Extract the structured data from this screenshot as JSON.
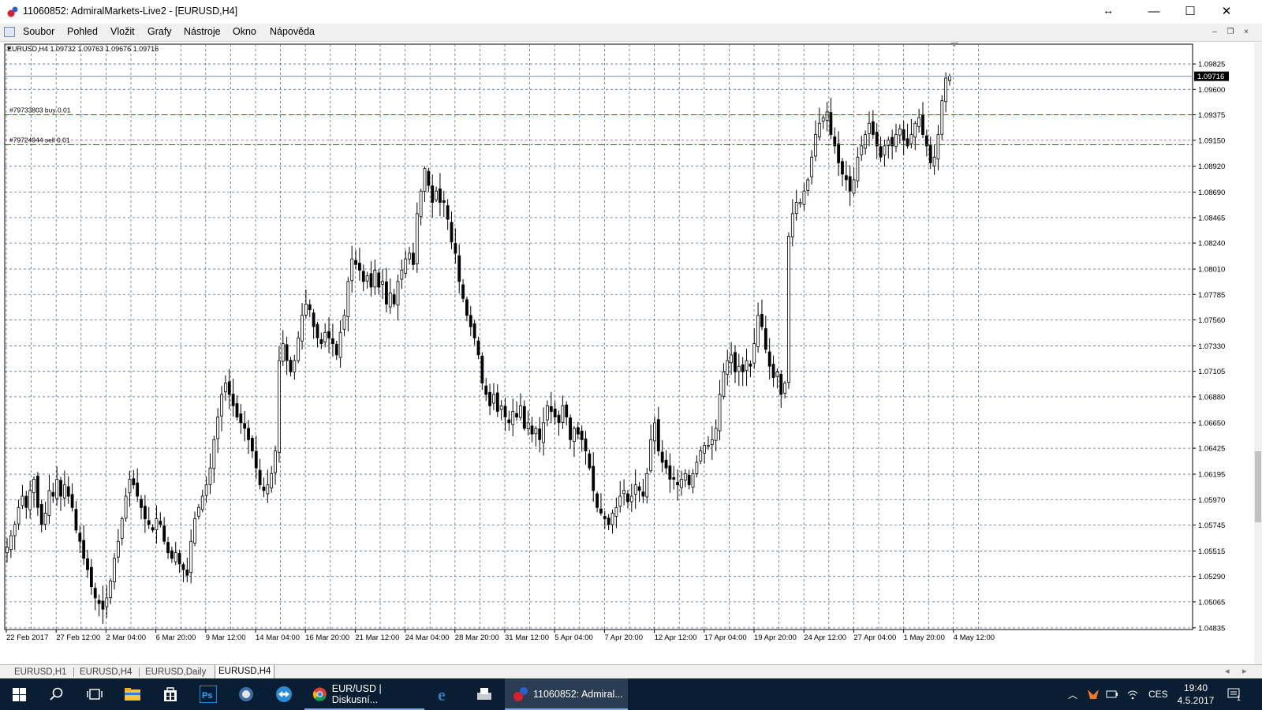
{
  "window": {
    "title": "11060852: AdmiralMarkets-Live2 - [EURUSD,H4]",
    "controls": {
      "minimize": "—",
      "maximize": "☐",
      "close": "✕"
    },
    "resize_glyph": "↔"
  },
  "menu": {
    "items": [
      "Soubor",
      "Pohled",
      "Vložit",
      "Grafy",
      "Nástroje",
      "Okno",
      "Nápověda"
    ],
    "mdi": {
      "minimize": "–",
      "restore": "❐",
      "close": "×"
    }
  },
  "chart": {
    "info": "EURUSD,H4  1.09732 1.09763 1.09676 1.09716",
    "current_price": "1.09716",
    "orders": [
      {
        "label": "#79733803 buy 0.01",
        "price": 1.09375,
        "color": "#ff0000"
      },
      {
        "label": "#79724944 sell 0.01",
        "price": 1.0911,
        "color": "#ff0000"
      }
    ]
  },
  "chart_data": {
    "type": "candlestick",
    "symbol": "EURUSD",
    "timeframe": "H4",
    "ylim": [
      1.0482,
      1.1
    ],
    "y_ticks": [
      "1.09825",
      "1.09600",
      "1.09375",
      "1.09150",
      "1.08920",
      "1.08690",
      "1.08465",
      "1.08240",
      "1.08010",
      "1.07785",
      "1.07560",
      "1.07330",
      "1.07105",
      "1.06880",
      "1.06650",
      "1.06425",
      "1.06195",
      "1.05970",
      "1.05745",
      "1.05515",
      "1.05290",
      "1.05065",
      "1.04835"
    ],
    "x_ticks": [
      "22 Feb 2017",
      "27 Feb 12:00",
      "2 Mar 04:00",
      "6 Mar 20:00",
      "9 Mar 12:00",
      "14 Mar 04:00",
      "16 Mar 20:00",
      "21 Mar 12:00",
      "24 Mar 04:00",
      "28 Mar 20:00",
      "31 Mar 12:00",
      "5 Apr 04:00",
      "7 Apr 20:00",
      "12 Apr 12:00",
      "17 Apr 04:00",
      "19 Apr 20:00",
      "24 Apr 12:00",
      "27 Apr 04:00",
      "1 May 20:00",
      "4 May 12:00"
    ],
    "closes": [
      1.0555,
      1.0565,
      1.0575,
      1.059,
      1.06,
      1.059,
      1.0605,
      1.0615,
      1.059,
      1.0575,
      1.0585,
      1.0605,
      1.06,
      1.0615,
      1.06,
      1.061,
      1.06,
      1.059,
      1.057,
      1.056,
      1.0545,
      1.0535,
      1.052,
      1.051,
      1.0505,
      1.05,
      1.051,
      1.0525,
      1.0545,
      1.056,
      1.058,
      1.06,
      1.0615,
      1.061,
      1.06,
      1.059,
      1.058,
      1.0575,
      1.057,
      1.058,
      1.0575,
      1.056,
      1.055,
      1.0545,
      1.055,
      1.054,
      1.0535,
      1.053,
      1.056,
      1.058,
      1.059,
      1.06,
      1.061,
      1.0625,
      1.065,
      1.067,
      1.069,
      1.07,
      1.069,
      1.068,
      1.067,
      1.0665,
      1.066,
      1.065,
      1.064,
      1.0625,
      1.061,
      1.0605,
      1.061,
      1.062,
      1.064,
      1.072,
      1.0735,
      1.072,
      1.071,
      1.072,
      1.074,
      1.076,
      1.077,
      1.0765,
      1.075,
      1.074,
      1.0735,
      1.0745,
      1.074,
      1.0735,
      1.0725,
      1.0745,
      1.076,
      1.079,
      1.081,
      1.0805,
      1.08,
      1.079,
      1.0795,
      1.0785,
      1.08,
      1.0785,
      1.079,
      1.077,
      1.078,
      1.077,
      1.079,
      1.08,
      1.081,
      1.0815,
      1.0805,
      1.085,
      1.087,
      1.089,
      1.0875,
      1.086,
      1.087,
      1.086,
      1.086,
      1.0845,
      1.0825,
      1.0815,
      1.079,
      1.0775,
      1.076,
      1.075,
      1.074,
      1.0725,
      1.07,
      1.069,
      1.068,
      1.069,
      1.0675,
      1.068,
      1.067,
      1.0665,
      1.0675,
      1.067,
      1.068,
      1.066,
      1.0665,
      1.0655,
      1.066,
      1.065,
      1.0665,
      1.068,
      1.0675,
      1.067,
      1.0665,
      1.068,
      1.067,
      1.065,
      1.066,
      1.0655,
      1.065,
      1.064,
      1.0625,
      1.0605,
      1.059,
      1.0585,
      1.058,
      1.0575,
      1.0585,
      1.059,
      1.06,
      1.0605,
      1.0595,
      1.06,
      1.061,
      1.0605,
      1.06,
      1.062,
      1.065,
      1.0665,
      1.064,
      1.063,
      1.0625,
      1.0615,
      1.0615,
      1.061,
      1.0615,
      1.062,
      1.061,
      1.062,
      1.063,
      1.064,
      1.0645,
      1.0645,
      1.065,
      1.066,
      1.069,
      1.071,
      1.072,
      1.0725,
      1.071,
      1.0715,
      1.071,
      1.072,
      1.0715,
      1.0735,
      1.076,
      1.075,
      1.073,
      1.0715,
      1.0705,
      1.071,
      1.069,
      1.07,
      1.083,
      1.085,
      1.086,
      1.086,
      1.087,
      1.088,
      1.09,
      1.092,
      1.093,
      1.0935,
      1.094,
      1.092,
      1.091,
      1.0895,
      1.0885,
      1.088,
      1.087,
      1.088,
      1.09,
      1.091,
      1.092,
      1.093,
      1.092,
      1.091,
      1.09,
      1.091,
      1.0915,
      1.091,
      1.092,
      1.0925,
      1.0915,
      1.091,
      1.092,
      1.093,
      1.0935,
      1.092,
      1.091,
      1.0895,
      1.09,
      1.092,
      1.095,
      1.097,
      1.09716
    ]
  },
  "tabs": [
    "EURUSD,H1",
    "EURUSD,H4",
    "EURUSD,Daily",
    "EURUSD,H4"
  ],
  "active_tab_index": 3,
  "taskbar": {
    "apps": [
      {
        "label": "EUR/USD | Diskusní...",
        "icon": "chrome-icon"
      },
      {
        "label": "11060852: Admiral...",
        "icon": "metatrader-icon"
      }
    ],
    "language": "CES",
    "time": "19:40",
    "date": "4.5.2017",
    "notification_count": "1"
  },
  "colors": {
    "grid": "#5a6e86",
    "order_line": "#ff0000",
    "price_line": "#7b8fa6",
    "taskbar": "#0a1e33"
  }
}
